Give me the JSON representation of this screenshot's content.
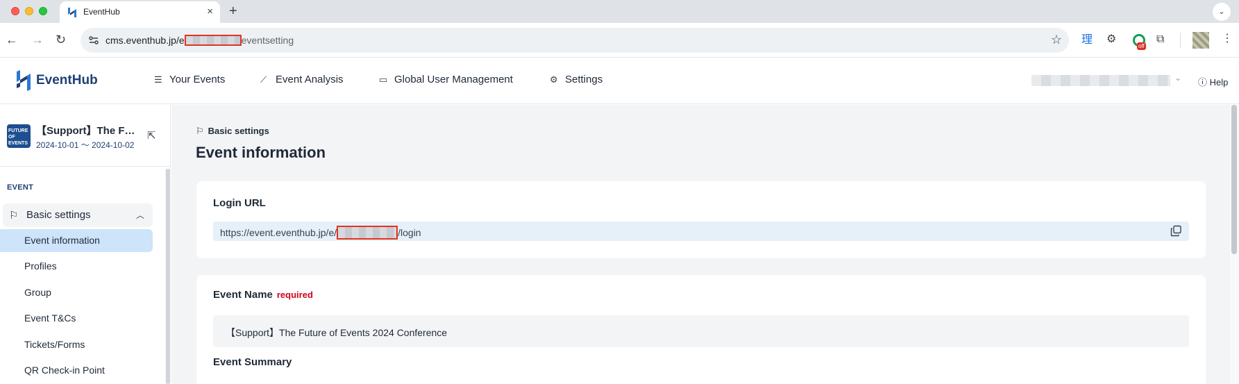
{
  "browser": {
    "tab_title": "EventHub",
    "tab_close": "×",
    "new_tab": "+",
    "url_prefix": "cms.eventhub.jp/e",
    "url_suffix": "eventsetting",
    "extension_badge": "off",
    "kanji_extension": "理"
  },
  "header": {
    "brand": "EventHub",
    "nav": [
      {
        "label": "Your Events",
        "icon": "list-icon"
      },
      {
        "label": "Event Analysis",
        "icon": "chart-icon"
      },
      {
        "label": "Global User Management",
        "icon": "id-card-icon"
      },
      {
        "label": "Settings",
        "icon": "gear-icon"
      }
    ],
    "help": "Help"
  },
  "sidebar": {
    "event_title": "【Support】The F…",
    "event_dates": "2024-10-01 ～ 2024-10-02",
    "thumb_text": "FUTURE OF EVENTS",
    "section": "EVENT",
    "group": "Basic settings",
    "items": [
      {
        "label": "Event information",
        "active": true
      },
      {
        "label": "Profiles"
      },
      {
        "label": "Group"
      },
      {
        "label": "Event T&Cs"
      },
      {
        "label": "Tickets/Forms"
      },
      {
        "label": "QR Check-in Point"
      }
    ]
  },
  "main": {
    "breadcrumb": "Basic settings",
    "title": "Event information",
    "login_url": {
      "label": "Login URL",
      "prefix": "https://event.eventhub.jp/e/",
      "suffix": "/login"
    },
    "event_name": {
      "label": "Event Name",
      "required": "required",
      "value": "【Support】The Future of Events 2024 Conference"
    },
    "event_summary_label": "Event Summary"
  },
  "colors": {
    "brand": "#1f3f75",
    "active_item": "#cde4fa",
    "required": "#d0021b",
    "redaction_border": "#e53222"
  }
}
